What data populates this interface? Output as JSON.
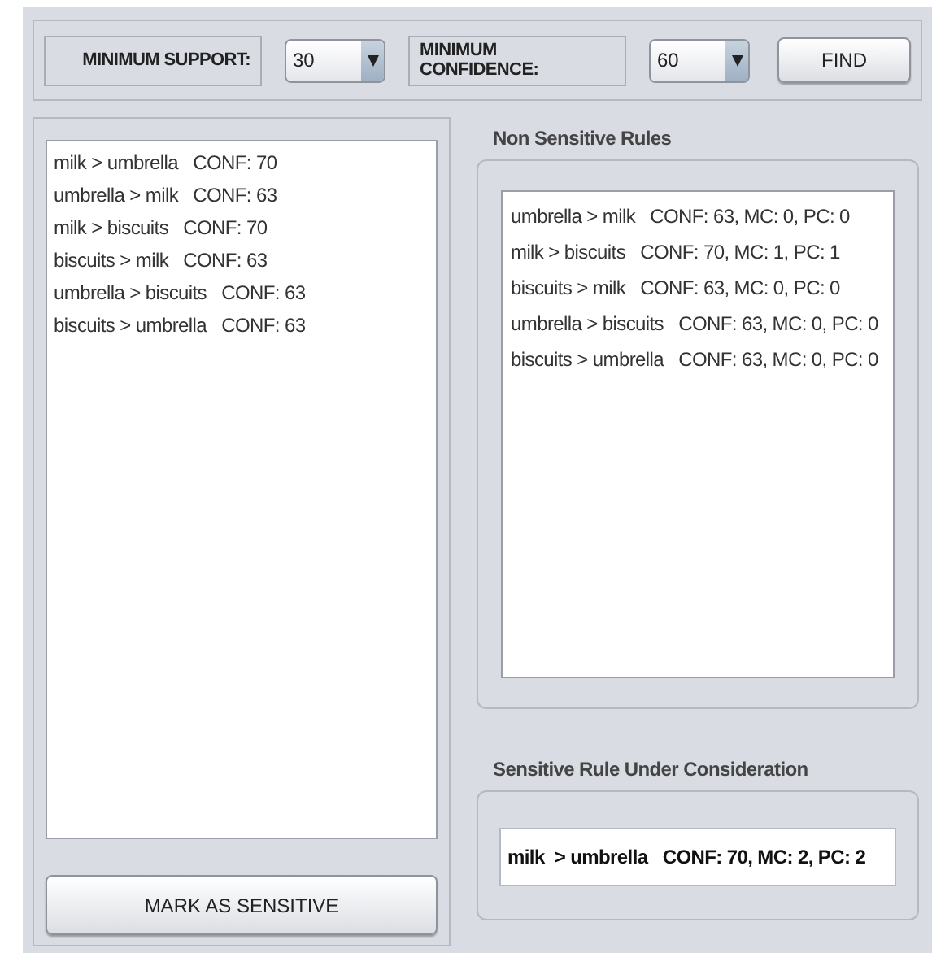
{
  "toolbar": {
    "support_label": "MINIMUM SUPPORT:",
    "support_value": "30",
    "confidence_label": "MINIMUM CONFIDENCE:",
    "confidence_value": "60",
    "find_button": "FIND"
  },
  "rules": [
    "milk > umbrella   CONF: 70",
    "umbrella > milk   CONF: 63",
    "milk > biscuits   CONF: 70",
    "biscuits > milk   CONF: 63",
    "umbrella > biscuits   CONF: 63",
    "biscuits > umbrella   CONF: 63"
  ],
  "mark_button": "MARK AS SENSITIVE",
  "non_sensitive": {
    "title": "Non Sensitive Rules",
    "rules": [
      "umbrella > milk   CONF: 63, MC: 0, PC: 0",
      "milk > biscuits   CONF: 70, MC: 1, PC: 1",
      "biscuits > milk   CONF: 63, MC: 0, PC: 0",
      "umbrella > biscuits   CONF: 63, MC: 0, PC: 0",
      "biscuits > umbrella   CONF: 63, MC: 0, PC: 0"
    ]
  },
  "sensitive": {
    "title": "Sensitive Rule Under Consideration",
    "rule": "milk  > umbrella   CONF: 70, MC: 2, PC: 2"
  }
}
